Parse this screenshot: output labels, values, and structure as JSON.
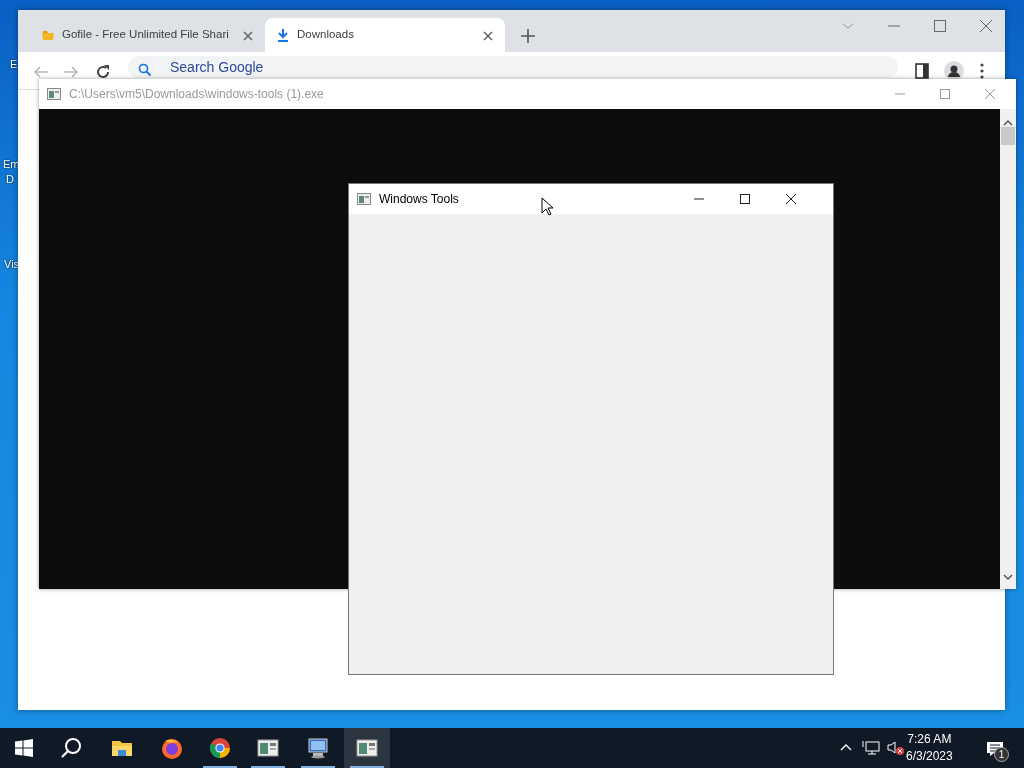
{
  "desktop": {
    "icon_labels": [
      {
        "text": "E"
      },
      {
        "text": "Em"
      },
      {
        "text": "D"
      },
      {
        "text": "Vis"
      }
    ]
  },
  "browser": {
    "tabs": [
      {
        "label": "Gofile - Free Unlimited File Shari",
        "selected": false,
        "kind": "folder"
      },
      {
        "label": "Downloads",
        "selected": true,
        "kind": "download"
      }
    ],
    "omnibox": {
      "placeholder": "Search Google"
    }
  },
  "console_window": {
    "title": "C:\\Users\\vm5\\Downloads\\windows-tools (1).exe",
    "active": false
  },
  "app_window": {
    "title": "Windows Tools",
    "active": true
  },
  "taskbar": {
    "apps": [
      {
        "kind": "explorer",
        "running": false,
        "selected": false
      },
      {
        "kind": "firefox",
        "running": false,
        "selected": false
      },
      {
        "kind": "chrome",
        "running": true,
        "selected": false
      },
      {
        "kind": "app",
        "running": true,
        "selected": false
      },
      {
        "kind": "terminal",
        "running": true,
        "selected": false
      },
      {
        "kind": "app",
        "running": true,
        "selected": true
      }
    ],
    "tray": {
      "muted": true,
      "time": "7:26 AM",
      "date": "6/3/2023",
      "notification_count": "1"
    }
  }
}
